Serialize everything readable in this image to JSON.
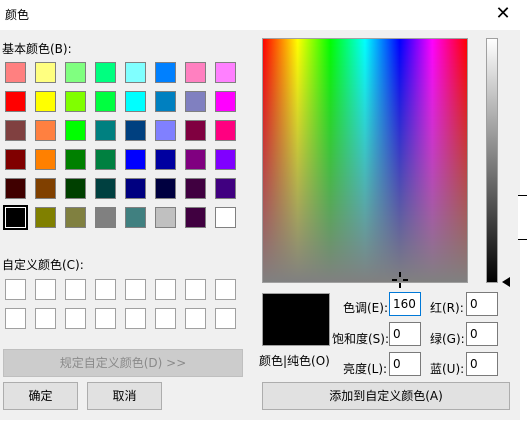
{
  "window": {
    "title": "颜色",
    "close_glyph": "✕"
  },
  "basic_colors_label": "基本颜色(B):",
  "basic_colors": [
    "#ff8080",
    "#ffff80",
    "#80ff80",
    "#00ff80",
    "#80ffff",
    "#0080ff",
    "#ff80c0",
    "#ff80ff",
    "#ff0000",
    "#ffff00",
    "#80ff00",
    "#00ff40",
    "#00ffff",
    "#0080c0",
    "#8080c0",
    "#ff00ff",
    "#804040",
    "#ff8040",
    "#00ff00",
    "#008080",
    "#004080",
    "#8080ff",
    "#800040",
    "#ff0080",
    "#800000",
    "#ff8000",
    "#008000",
    "#008040",
    "#0000ff",
    "#0000a0",
    "#800080",
    "#8000ff",
    "#400000",
    "#804000",
    "#004000",
    "#004040",
    "#000080",
    "#000040",
    "#400040",
    "#400080",
    "#000000",
    "#808000",
    "#808040",
    "#808080",
    "#408080",
    "#c0c0c0",
    "#400040",
    "#ffffff"
  ],
  "custom_colors_label": "自定义颜色(C):",
  "custom_colors_count": 16,
  "buttons": {
    "define_custom": "规定自定义颜色(D) >>",
    "ok": "确定",
    "cancel": "取消",
    "add_custom": "添加到自定义颜色(A)"
  },
  "preview_label": "颜色|纯色(O)",
  "preview_color": "#000000",
  "fields": {
    "hue": {
      "label": "色调(E):",
      "value": "160"
    },
    "saturation": {
      "label": "饱和度(S):",
      "value": "0"
    },
    "luminance": {
      "label": "亮度(L):",
      "value": "0"
    },
    "red": {
      "label": "红(R):",
      "value": "0"
    },
    "green": {
      "label": "绿(G):",
      "value": "0"
    },
    "blue": {
      "label": "蓝(U):",
      "value": "0"
    }
  }
}
